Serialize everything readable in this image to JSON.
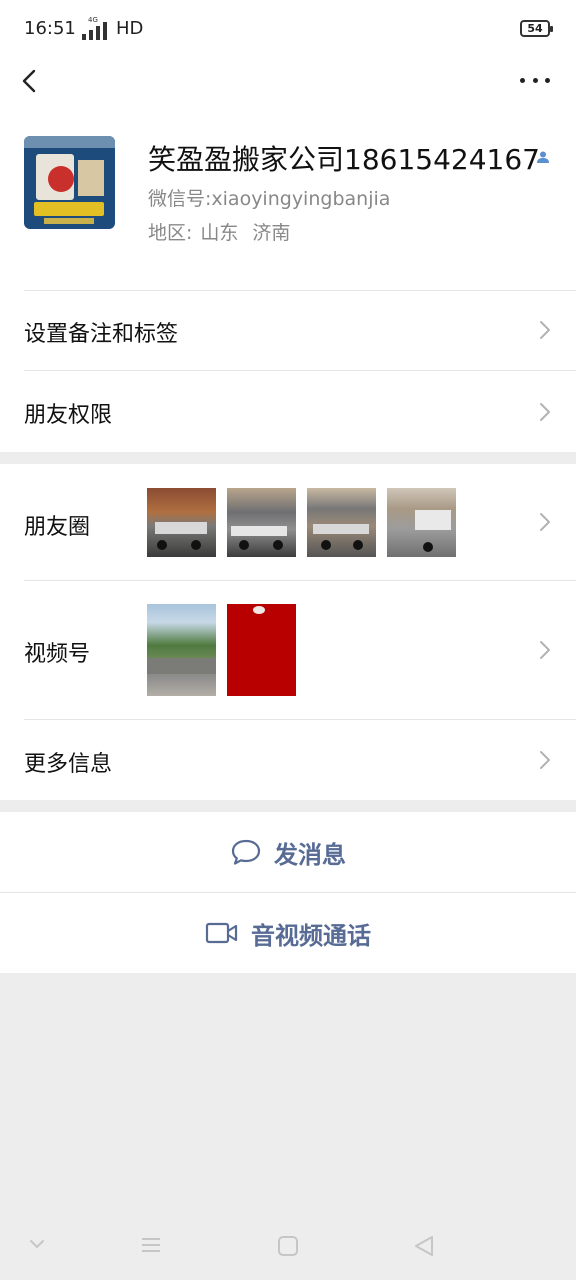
{
  "status_bar": {
    "time": "16:51",
    "network": "4G",
    "hd": "HD",
    "battery": "54"
  },
  "nav": {
    "back_icon": "chevron-left-icon",
    "more_icon": "more-dots-icon"
  },
  "profile": {
    "name": "笑盈盈搬家公司18615424167",
    "wechat_id": "微信号:xiaoyingyingbanjia",
    "region_label": "地区:",
    "region_province": "山东",
    "region_city": "济南",
    "badge_icon": "person-icon"
  },
  "rows": {
    "remark": "设置备注和标签",
    "permissions": "朋友权限",
    "moments": "朋友圈",
    "channels": "视频号",
    "more_info": "更多信息"
  },
  "actions": {
    "message": "发消息",
    "message_icon": "chat-bubble-icon",
    "call": "音视频通话",
    "call_icon": "video-camera-icon"
  },
  "colors": {
    "link": "#576b95",
    "background": "#ededed",
    "channels_red": "#b90000"
  }
}
